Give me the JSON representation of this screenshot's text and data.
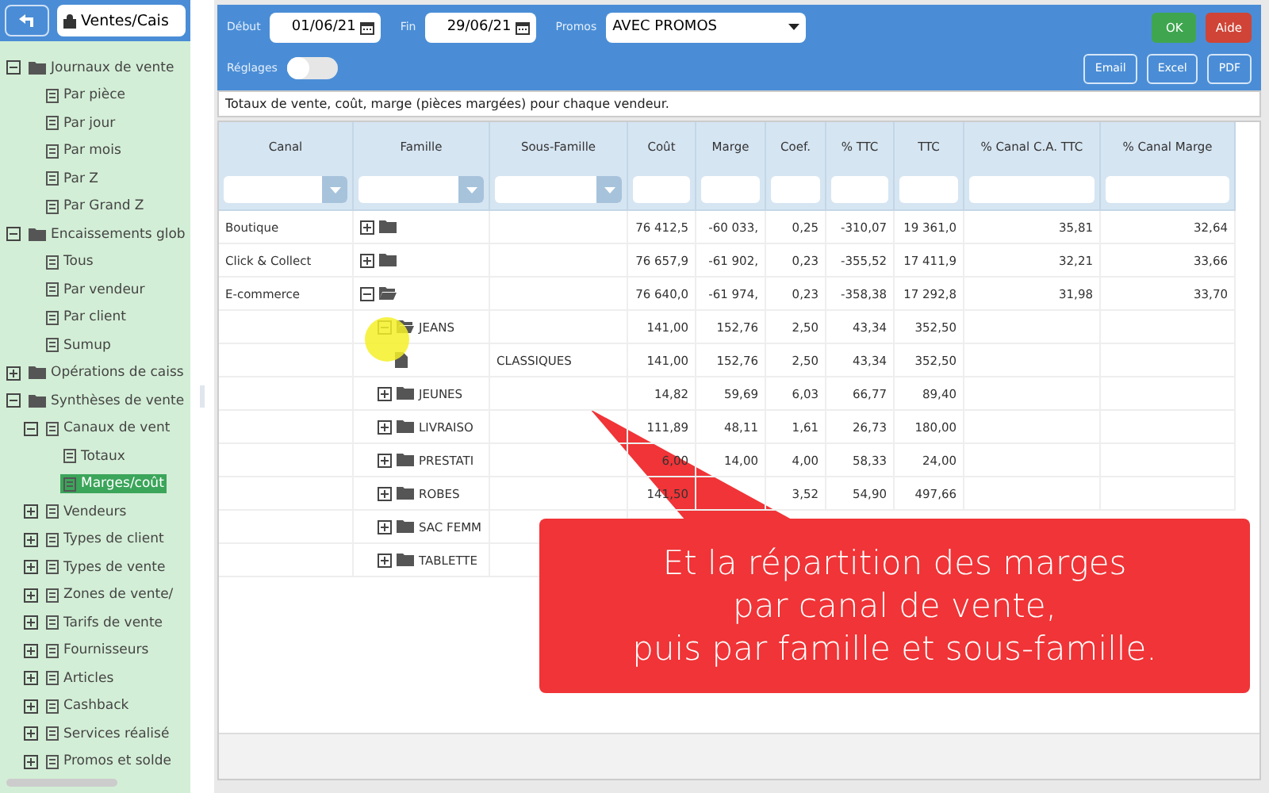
{
  "sidebar": {
    "selector": {
      "value": "Ventes/Cais"
    },
    "tree": [
      {
        "label": "Journaux de vente",
        "kind": "folder",
        "expanded": true,
        "selected": false,
        "children": [
          {
            "label": "Par pièce",
            "kind": "item",
            "selected": false
          },
          {
            "label": "Par jour",
            "kind": "item",
            "selected": false
          },
          {
            "label": "Par mois",
            "kind": "item",
            "selected": false
          },
          {
            "label": "Par Z",
            "kind": "item",
            "selected": false
          },
          {
            "label": "Par Grand Z",
            "kind": "item",
            "selected": false
          }
        ]
      },
      {
        "label": "Encaissements glob",
        "kind": "folder",
        "expanded": true,
        "selected": false,
        "children": [
          {
            "label": "Tous",
            "kind": "item",
            "selected": false
          },
          {
            "label": "Par vendeur",
            "kind": "item",
            "selected": false
          },
          {
            "label": "Par client",
            "kind": "item",
            "selected": false
          },
          {
            "label": "Sumup",
            "kind": "item",
            "selected": false
          }
        ]
      },
      {
        "label": "Opérations de caiss",
        "kind": "folder",
        "expanded": false,
        "selected": false
      },
      {
        "label": "Synthèses de vente",
        "kind": "folder",
        "expanded": true,
        "selected": false,
        "children": [
          {
            "label": "Canaux de vent",
            "kind": "item",
            "expanded": true,
            "selected": false,
            "children": [
              {
                "label": "Totaux",
                "kind": "item",
                "selected": false
              },
              {
                "label": "Marges/coût",
                "kind": "item",
                "selected": true
              }
            ]
          },
          {
            "label": "Vendeurs",
            "kind": "item",
            "expanded": false,
            "selected": false
          },
          {
            "label": "Types de client",
            "kind": "item",
            "expanded": false,
            "selected": false
          },
          {
            "label": "Types de vente",
            "kind": "item",
            "expanded": false,
            "selected": false
          },
          {
            "label": "Zones de vente/",
            "kind": "item",
            "expanded": false,
            "selected": false
          },
          {
            "label": "Tarifs de vente",
            "kind": "item",
            "expanded": false,
            "selected": false
          },
          {
            "label": "Fournisseurs",
            "kind": "item",
            "expanded": false,
            "selected": false
          },
          {
            "label": "Articles",
            "kind": "item",
            "expanded": false,
            "selected": false
          },
          {
            "label": "Cashback",
            "kind": "item",
            "expanded": false,
            "selected": false
          },
          {
            "label": "Services réalisé",
            "kind": "item",
            "expanded": false,
            "selected": false
          },
          {
            "label": "Promos et solde",
            "kind": "item",
            "expanded": false,
            "selected": false
          }
        ]
      }
    ]
  },
  "toolbar": {
    "start": {
      "label": "Début",
      "value": "01/06/21"
    },
    "end": {
      "label": "Fin",
      "value": "29/06/21"
    },
    "promos": {
      "label": "Promos",
      "value": "AVEC PROMOS"
    },
    "ok": "OK",
    "help": "Aide",
    "settings": {
      "label": "Réglages",
      "on": false
    },
    "exports": [
      "Email",
      "Excel",
      "PDF"
    ]
  },
  "description": "Totaux de vente, coût, marge (pièces margées) pour chaque vendeur.",
  "table": {
    "columns": [
      {
        "label": "Canal",
        "kind": "select"
      },
      {
        "label": "Famille",
        "kind": "select"
      },
      {
        "label": "Sous-Famille",
        "kind": "select"
      },
      {
        "label": "Coût",
        "kind": "text"
      },
      {
        "label": "Marge",
        "kind": "text"
      },
      {
        "label": "Coef.",
        "kind": "text"
      },
      {
        "label": "% TTC",
        "kind": "text"
      },
      {
        "label": "TTC",
        "kind": "text"
      },
      {
        "label": "% Canal C.A. TTC",
        "kind": "text"
      },
      {
        "label": "% Canal Marge",
        "kind": "text"
      }
    ],
    "rows": [
      {
        "canal": "Boutique",
        "kind": "folder",
        "expanded": false,
        "cells": {
          "cout": "76 412,5",
          "marge": "-60 033,",
          "coef": "0,25",
          "pct_ttc": "-310,07",
          "ttc": "19 361,0",
          "pct_canal_ca": "35,81",
          "pct_canal_marge": "32,64"
        }
      },
      {
        "canal": "Click & Collect",
        "kind": "folder",
        "expanded": false,
        "cells": {
          "cout": "76 657,9",
          "marge": "-61 902,",
          "coef": "0,23",
          "pct_ttc": "-355,52",
          "ttc": "17 411,9",
          "pct_canal_ca": "32,21",
          "pct_canal_marge": "33,66"
        }
      },
      {
        "canal": "E-commerce",
        "kind": "folder",
        "expanded": true,
        "cells": {
          "cout": "76 640,0",
          "marge": "-61 974,",
          "coef": "0,23",
          "pct_ttc": "-358,38",
          "ttc": "17 292,8",
          "pct_canal_ca": "31,98",
          "pct_canal_marge": "33,70"
        },
        "children": [
          {
            "famille": "JEANS",
            "kind": "folder",
            "expanded": true,
            "cells": {
              "cout": "141,00",
              "marge": "152,76",
              "coef": "2,50",
              "pct_ttc": "43,34",
              "ttc": "352,50"
            },
            "children": [
              {
                "sous_famille": "CLASSIQUES",
                "kind": "file",
                "cells": {
                  "cout": "141,00",
                  "marge": "152,76",
                  "coef": "2,50",
                  "pct_ttc": "43,34",
                  "ttc": "352,50"
                }
              }
            ]
          },
          {
            "famille": "JEUNES",
            "kind": "folder",
            "expanded": false,
            "cells": {
              "cout": "14,82",
              "marge": "59,69",
              "coef": "6,03",
              "pct_ttc": "66,77",
              "ttc": "89,40"
            }
          },
          {
            "famille": "LIVRAISO",
            "kind": "folder",
            "expanded": false,
            "cells": {
              "cout": "111,89",
              "marge": "48,11",
              "coef": "1,61",
              "pct_ttc": "26,73",
              "ttc": "180,00"
            }
          },
          {
            "famille": "PRESTATI",
            "kind": "folder",
            "expanded": false,
            "cells": {
              "cout": "6,00",
              "marge": "14,00",
              "coef": "4,00",
              "pct_ttc": "58,33",
              "ttc": "24,00"
            }
          },
          {
            "famille": "ROBES",
            "kind": "folder",
            "expanded": false,
            "cells": {
              "cout": "141,50",
              "coef": "3,52",
              "pct_ttc": "54,90",
              "ttc": "497,66"
            }
          },
          {
            "famille": "SAC FEMM",
            "kind": "folder",
            "expanded": false
          },
          {
            "famille": "TABLETTE",
            "kind": "folder",
            "expanded": false
          }
        ]
      }
    ]
  },
  "callout": {
    "lines": [
      "Et la répartition des marges",
      "par canal de vente,",
      "puis par famille et sous-famille."
    ]
  }
}
